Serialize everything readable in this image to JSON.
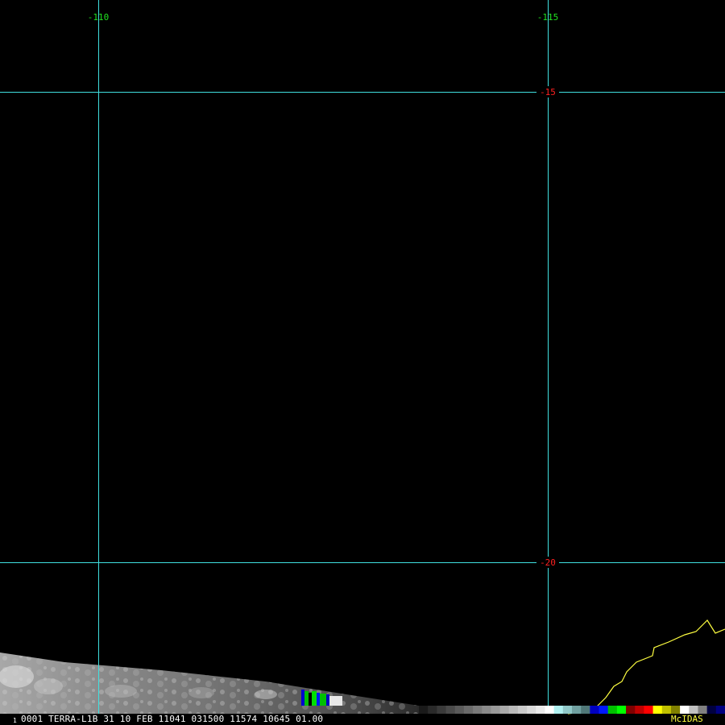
{
  "map": {
    "longitude_labels": [
      "-110",
      "-115"
    ],
    "latitude_labels": [
      "-15",
      "-20"
    ],
    "colors": {
      "background": "#000000",
      "graticule": "#40e0e0",
      "longitude_label": "#20e020",
      "latitude_label": "#ff2020",
      "coastline": "#ffff40"
    }
  },
  "footer": {
    "frame_number": "1",
    "header_text": "0001 TERRA-L1B 31 10 FEB 11041 031500 11574 10645 01.00",
    "brand": "McIDAS"
  },
  "color_bar": {
    "segments": [
      "#1a1a1a",
      "#2a2a2a",
      "#3a3a3a",
      "#4a4a4a",
      "#5a5a5a",
      "#6a6a6a",
      "#7a7a7a",
      "#8a8a8a",
      "#9a9a9a",
      "#aaaaaa",
      "#bababa",
      "#cacaca",
      "#dadada",
      "#eaeaea",
      "#ffffff",
      "#b0f0f0",
      "#90c8c8",
      "#70a0a0",
      "#507878",
      "#0000c0",
      "#0018ff",
      "#00c000",
      "#00ff00",
      "#800000",
      "#c00000",
      "#ff0000",
      "#ffff00",
      "#c0c000",
      "#808000",
      "#ffffff",
      "#c0c0c0",
      "#808080",
      "#000040",
      "#000080"
    ]
  }
}
